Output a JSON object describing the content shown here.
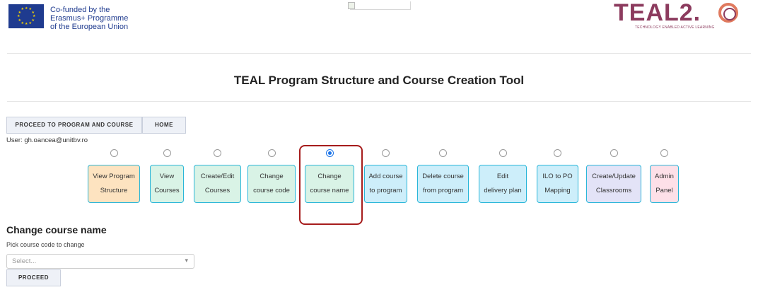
{
  "header": {
    "eu_text": [
      "Co-funded by the",
      "Erasmus+ Programme",
      "of the European Union"
    ],
    "eu_flag_color": "#1f3b8f",
    "teal_logo": {
      "word": "TEAL2.",
      "tagline": "TECHNOLOGY ENABLED ACTIVE LEARNING",
      "color": "#8c3b5e"
    },
    "broken_image_icon": "broken-image-icon"
  },
  "page_title": "TEAL Program Structure and Course Creation Tool",
  "nav": {
    "proceed_label": "PROCEED TO PROGRAM AND COURSE",
    "home_label": "HOME"
  },
  "user_line": "User: gh.oancea@unitbv.ro",
  "steps": [
    {
      "lines": [
        "View Program",
        "Structure"
      ],
      "bg": "#fde3c0",
      "checked": false
    },
    {
      "lines": [
        "View",
        "Courses"
      ],
      "bg": "#d9f3e6",
      "checked": false
    },
    {
      "lines": [
        "Create/Edit",
        "Courses"
      ],
      "bg": "#d9f3e6",
      "checked": false
    },
    {
      "lines": [
        "Change",
        "course code"
      ],
      "bg": "#d9f3e6",
      "checked": false
    },
    {
      "lines": [
        "Change",
        "course name"
      ],
      "bg": "#d9f3e6",
      "checked": true
    },
    {
      "lines": [
        "Add course",
        "to program"
      ],
      "bg": "#cdeefa",
      "checked": false
    },
    {
      "lines": [
        "Delete course",
        "from program"
      ],
      "bg": "#cdeefa",
      "checked": false
    },
    {
      "lines": [
        "Edit",
        "delivery plan"
      ],
      "bg": "#cdeefa",
      "checked": false
    },
    {
      "lines": [
        "ILO to PO",
        "Mapping"
      ],
      "bg": "#cdeefa",
      "checked": false
    },
    {
      "lines": [
        "Create/Update",
        "Classrooms"
      ],
      "bg": "#e3e3f7",
      "checked": false
    },
    {
      "lines": [
        "Admin",
        "Panel"
      ],
      "bg": "#fde0e8",
      "checked": false
    }
  ],
  "section": {
    "title": "Change course name",
    "hint": "Pick course code to change",
    "select_placeholder": "Select...",
    "proceed_label": "PROCEED"
  },
  "colors": {
    "accent_border": "#29b6d9",
    "highlight": "#a61c1c",
    "radio_checked": "#1a73e8"
  }
}
